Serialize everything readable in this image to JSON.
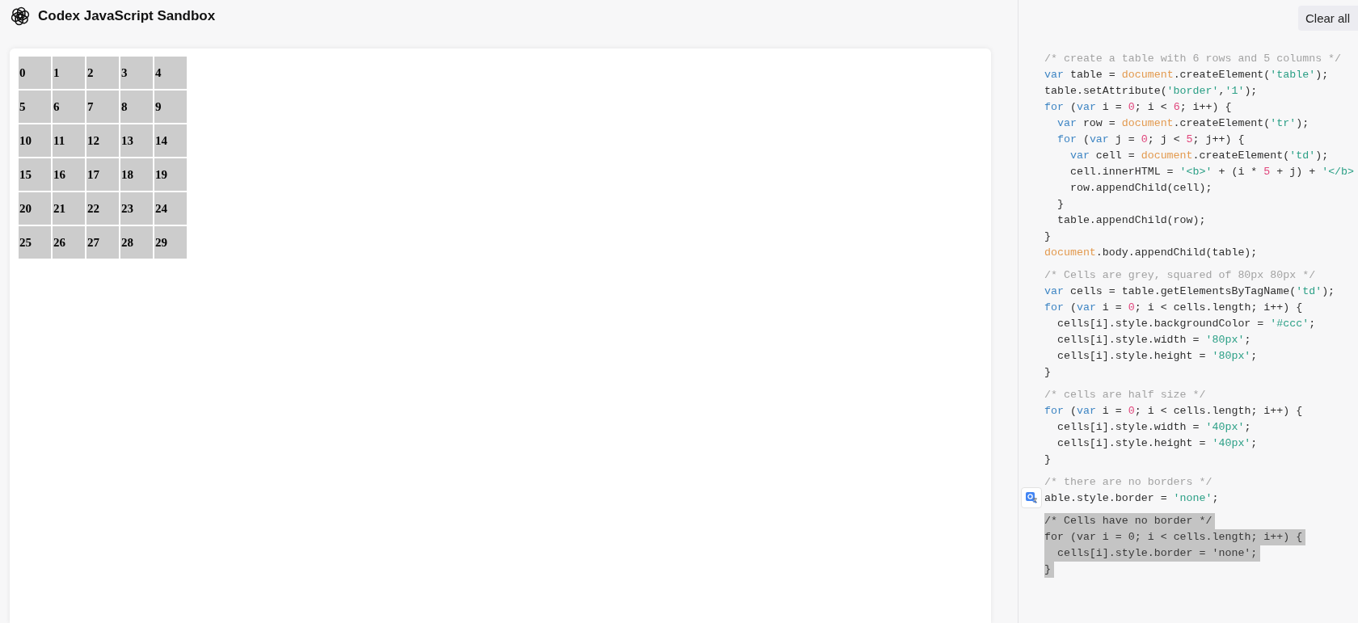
{
  "header": {
    "title": "Codex JavaScript Sandbox"
  },
  "output": {
    "table": {
      "rows": [
        [
          "0",
          "1",
          "2",
          "3",
          "4"
        ],
        [
          "5",
          "6",
          "7",
          "8",
          "9"
        ],
        [
          "10",
          "11",
          "12",
          "13",
          "14"
        ],
        [
          "15",
          "16",
          "17",
          "18",
          "19"
        ],
        [
          "20",
          "21",
          "22",
          "23",
          "24"
        ],
        [
          "25",
          "26",
          "27",
          "28",
          "29"
        ]
      ]
    }
  },
  "code_panel": {
    "clear_button": "Clear all",
    "blocks": [
      {
        "selected": false,
        "lines": [
          [
            {
              "kind": "comment",
              "text": "/* create a table with 6 rows and 5 columns */"
            }
          ],
          [
            {
              "kind": "keyword",
              "text": "var"
            },
            {
              "kind": "plain",
              "text": " table = "
            },
            {
              "kind": "builtin",
              "text": "document"
            },
            {
              "kind": "plain",
              "text": ".createElement("
            },
            {
              "kind": "string",
              "text": "'table'"
            },
            {
              "kind": "plain",
              "text": ");"
            }
          ],
          [
            {
              "kind": "plain",
              "text": "table.setAttribute("
            },
            {
              "kind": "string",
              "text": "'border'"
            },
            {
              "kind": "plain",
              "text": ","
            },
            {
              "kind": "string",
              "text": "'1'"
            },
            {
              "kind": "plain",
              "text": ");"
            }
          ],
          [
            {
              "kind": "keyword",
              "text": "for"
            },
            {
              "kind": "plain",
              "text": " ("
            },
            {
              "kind": "keyword",
              "text": "var"
            },
            {
              "kind": "plain",
              "text": " i = "
            },
            {
              "kind": "number",
              "text": "0"
            },
            {
              "kind": "plain",
              "text": "; i < "
            },
            {
              "kind": "number",
              "text": "6"
            },
            {
              "kind": "plain",
              "text": "; i++) {"
            }
          ],
          [
            {
              "kind": "keyword",
              "text": "  var"
            },
            {
              "kind": "plain",
              "text": " row = "
            },
            {
              "kind": "builtin",
              "text": "document"
            },
            {
              "kind": "plain",
              "text": ".createElement("
            },
            {
              "kind": "string",
              "text": "'tr'"
            },
            {
              "kind": "plain",
              "text": ");"
            }
          ],
          [
            {
              "kind": "keyword",
              "text": "  for"
            },
            {
              "kind": "plain",
              "text": " ("
            },
            {
              "kind": "keyword",
              "text": "var"
            },
            {
              "kind": "plain",
              "text": " j = "
            },
            {
              "kind": "number",
              "text": "0"
            },
            {
              "kind": "plain",
              "text": "; j < "
            },
            {
              "kind": "number",
              "text": "5"
            },
            {
              "kind": "plain",
              "text": "; j++) {"
            }
          ],
          [
            {
              "kind": "keyword",
              "text": "    var"
            },
            {
              "kind": "plain",
              "text": " cell = "
            },
            {
              "kind": "builtin",
              "text": "document"
            },
            {
              "kind": "plain",
              "text": ".createElement("
            },
            {
              "kind": "string",
              "text": "'td'"
            },
            {
              "kind": "plain",
              "text": ");"
            }
          ],
          [
            {
              "kind": "plain",
              "text": "    cell.innerHTML = "
            },
            {
              "kind": "string",
              "text": "'<b>'"
            },
            {
              "kind": "plain",
              "text": " + (i * "
            },
            {
              "kind": "number",
              "text": "5"
            },
            {
              "kind": "plain",
              "text": " + j) + "
            },
            {
              "kind": "string",
              "text": "'</b>"
            }
          ],
          [
            {
              "kind": "plain",
              "text": "    row.appendChild(cell);"
            }
          ],
          [
            {
              "kind": "plain",
              "text": "  }"
            }
          ],
          [
            {
              "kind": "plain",
              "text": "  table.appendChild(row);"
            }
          ],
          [
            {
              "kind": "plain",
              "text": "}"
            }
          ],
          [
            {
              "kind": "builtin",
              "text": "document"
            },
            {
              "kind": "plain",
              "text": ".body.appendChild(table);"
            }
          ]
        ]
      },
      {
        "selected": false,
        "lines": [
          [
            {
              "kind": "comment",
              "text": "/* Cells are grey, squared of 80px 80px */"
            }
          ],
          [
            {
              "kind": "keyword",
              "text": "var"
            },
            {
              "kind": "plain",
              "text": " cells = table.getElementsByTagName("
            },
            {
              "kind": "string",
              "text": "'td'"
            },
            {
              "kind": "plain",
              "text": ");"
            }
          ],
          [
            {
              "kind": "keyword",
              "text": "for"
            },
            {
              "kind": "plain",
              "text": " ("
            },
            {
              "kind": "keyword",
              "text": "var"
            },
            {
              "kind": "plain",
              "text": " i = "
            },
            {
              "kind": "number",
              "text": "0"
            },
            {
              "kind": "plain",
              "text": "; i < cells.length; i++) {"
            }
          ],
          [
            {
              "kind": "plain",
              "text": "  cells[i].style.backgroundColor = "
            },
            {
              "kind": "string",
              "text": "'#ccc'"
            },
            {
              "kind": "plain",
              "text": ";"
            }
          ],
          [
            {
              "kind": "plain",
              "text": "  cells[i].style.width = "
            },
            {
              "kind": "string",
              "text": "'80px'"
            },
            {
              "kind": "plain",
              "text": ";"
            }
          ],
          [
            {
              "kind": "plain",
              "text": "  cells[i].style.height = "
            },
            {
              "kind": "string",
              "text": "'80px'"
            },
            {
              "kind": "plain",
              "text": ";"
            }
          ],
          [
            {
              "kind": "plain",
              "text": "}"
            }
          ]
        ]
      },
      {
        "selected": false,
        "lines": [
          [
            {
              "kind": "comment",
              "text": "/* cells are half size */"
            }
          ],
          [
            {
              "kind": "keyword",
              "text": "for"
            },
            {
              "kind": "plain",
              "text": " ("
            },
            {
              "kind": "keyword",
              "text": "var"
            },
            {
              "kind": "plain",
              "text": " i = "
            },
            {
              "kind": "number",
              "text": "0"
            },
            {
              "kind": "plain",
              "text": "; i < cells.length; i++) {"
            }
          ],
          [
            {
              "kind": "plain",
              "text": "  cells[i].style.width = "
            },
            {
              "kind": "string",
              "text": "'40px'"
            },
            {
              "kind": "plain",
              "text": ";"
            }
          ],
          [
            {
              "kind": "plain",
              "text": "  cells[i].style.height = "
            },
            {
              "kind": "string",
              "text": "'40px'"
            },
            {
              "kind": "plain",
              "text": ";"
            }
          ],
          [
            {
              "kind": "plain",
              "text": "}"
            }
          ]
        ]
      },
      {
        "selected": false,
        "lines": [
          [
            {
              "kind": "comment",
              "text": "/* there are no borders */"
            }
          ],
          [
            {
              "kind": "plain",
              "text": "able.style.border = "
            },
            {
              "kind": "string",
              "text": "'none'"
            },
            {
              "kind": "plain",
              "text": ";"
            }
          ]
        ]
      },
      {
        "selected": true,
        "lines": [
          [
            {
              "kind": "comment",
              "text": "/* Cells have no border */"
            }
          ],
          [
            {
              "kind": "keyword",
              "text": "for"
            },
            {
              "kind": "plain",
              "text": " ("
            },
            {
              "kind": "keyword",
              "text": "var"
            },
            {
              "kind": "plain",
              "text": " i = "
            },
            {
              "kind": "number",
              "text": "0"
            },
            {
              "kind": "plain",
              "text": "; i < cells.length; i++) {"
            }
          ],
          [
            {
              "kind": "plain",
              "text": "  cells[i].style.border = "
            },
            {
              "kind": "string",
              "text": "'none'"
            },
            {
              "kind": "plain",
              "text": ";"
            }
          ],
          [
            {
              "kind": "plain",
              "text": "}"
            }
          ]
        ]
      }
    ]
  }
}
